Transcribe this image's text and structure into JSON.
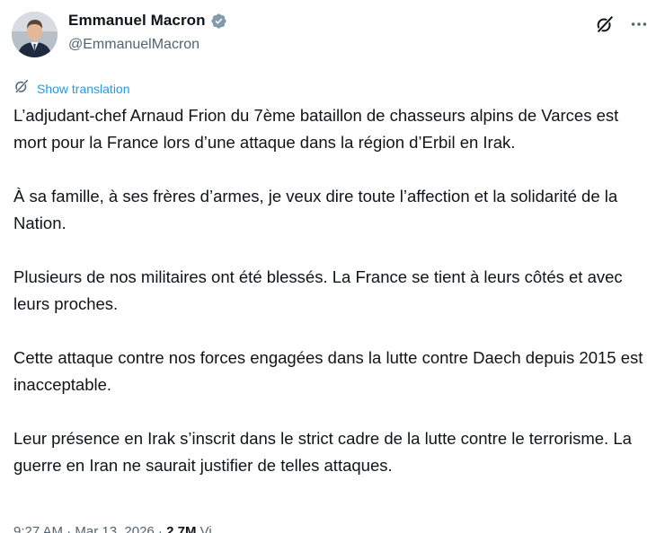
{
  "author": {
    "display_name": "Emmanuel Macron",
    "handle": "@EmmanuelMacron",
    "verified_color": "#829aab"
  },
  "actions": {
    "grok_icon": "grok-icon",
    "more_icon": "more-options-icon"
  },
  "translation": {
    "label": "Show translation",
    "icon": "translate-icon",
    "color": "#1d9bf0"
  },
  "tweet": {
    "paragraphs": [
      "L’adjudant-chef Arnaud Frion du 7ème bataillon de chasseurs alpins de Varces est mort pour la France lors d’une attaque dans la région d’Erbil en Irak.",
      "À sa famille, à ses frères d’armes, je veux dire toute l’affection et la solidarité de la Nation.",
      "Plusieurs de nos militaires ont été blessés. La France se tient à leurs côtés et avec leurs proches.",
      "Cette attaque contre nos forces engagées dans la lutte contre Daech depuis 2015 est inacceptable.",
      "Leur présence en Irak s’inscrit dans le strict cadre de la lutte contre le terrorisme. La guerre en Iran ne saurait justifier de telles attaques."
    ]
  },
  "meta": {
    "timestamp": "9:27 AM · Mar 13, 2026 · ",
    "views": "2.7M",
    "views_suffix": " Vi"
  }
}
